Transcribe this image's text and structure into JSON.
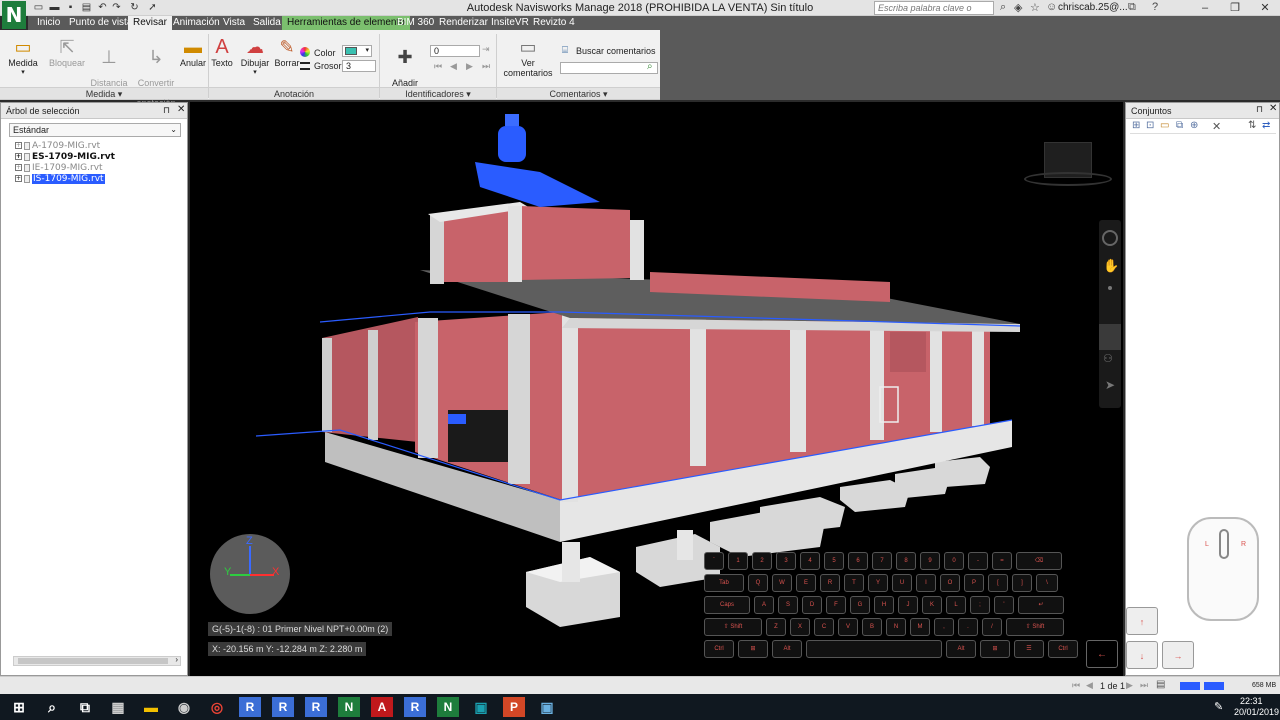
{
  "title_bar": {
    "app_letter": "N",
    "window_title": "Autodesk Navisworks Manage 2018 (PROHIBIDA LA VENTA)   Sin título",
    "search_placeholder": "Escriba palabra clave o frase",
    "user": "chriscab.25@...",
    "window_buttons": [
      "–",
      "❐",
      "✕"
    ]
  },
  "menu": {
    "tabs": [
      "Inicio",
      "Punto de vista",
      "Revisar",
      "Animación",
      "Vista",
      "Salida",
      "Herramientas de elemento",
      "BIM 360",
      "Renderizar",
      "InsiteVR",
      "Revizto 4"
    ],
    "active": "Revisar",
    "highlighted": "Herramientas de elemento"
  },
  "ribbon": {
    "medida": {
      "measure": "Medida",
      "lock": "Bloquear",
      "distance": "Distancia\nmás corta",
      "convert": "Convertir\nen anotación",
      "clear": "Anular",
      "group_label": "Medida"
    },
    "anotacion": {
      "text": "Texto",
      "draw": "Dibujar",
      "erase": "Borrar",
      "color_label": "Color",
      "thickness_label": "Grosor:",
      "thickness_value": "3",
      "group_label": "Anotación"
    },
    "identificadores": {
      "add": "Añadir\nidentificador",
      "id_value": "0",
      "group_label": "Identificadores"
    },
    "comentarios": {
      "view": "Ver comentarios",
      "search": "Buscar comentarios",
      "group_label": "Comentarios"
    }
  },
  "selection_tree": {
    "title": "Árbol de selección",
    "dropdown": "Estándar",
    "items": [
      {
        "label": "A-1709-MIG.rvt",
        "state": "dim"
      },
      {
        "label": "ES-1709-MIG.rvt",
        "state": "bold"
      },
      {
        "label": "IE-1709-MIG.rvt",
        "state": "dim"
      },
      {
        "label": "IS-1709-MIG.rvt",
        "state": "selected"
      }
    ]
  },
  "sets_panel": {
    "title": "Conjuntos"
  },
  "viewport": {
    "grid_location": "G(-5)-1(-8) : 01 Primer Nivel NPT+0.00m (2)",
    "coordinates": "X: -20.156 m  Y: -12.284 m  Z: 2.280 m",
    "axis_labels": {
      "z": "Z",
      "y": "Y",
      "x": "X"
    }
  },
  "keyboard": {
    "rows": [
      [
        "`",
        "1",
        "2",
        "3",
        "4",
        "5",
        "6",
        "7",
        "8",
        "9",
        "0",
        "-",
        "=",
        "⌫"
      ],
      [
        "Tab",
        "Q",
        "W",
        "E",
        "R",
        "T",
        "Y",
        "U",
        "I",
        "O",
        "P",
        "[",
        "]",
        "\\"
      ],
      [
        "Caps",
        "A",
        "S",
        "D",
        "F",
        "G",
        "H",
        "J",
        "K",
        "L",
        ";",
        "'",
        "↵"
      ],
      [
        "⇧ Shift",
        "Z",
        "X",
        "C",
        "V",
        "B",
        "N",
        "M",
        ",",
        ".",
        "/",
        "⇧ Shift"
      ],
      [
        "Ctrl",
        "⊞",
        "Alt",
        "",
        "Alt",
        "⊞",
        "☰",
        "Ctrl"
      ]
    ],
    "arrow_keys": {
      "up": "↑",
      "down": "↓",
      "right": "→",
      "left": "←"
    },
    "mouse_labels": {
      "left": "L",
      "right": "R"
    }
  },
  "status_bar": {
    "page": "1 de 1",
    "memory": "658 MB"
  },
  "taskbar": {
    "time": "22:31",
    "date": "20/01/2019",
    "apps": [
      "windows-icon",
      "search-icon",
      "task-view-icon",
      "calculator-icon",
      "file-explorer-icon",
      "app-icon",
      "chrome-icon",
      "revit-icon",
      "revit-icon",
      "revit-icon",
      "navisworks-icon",
      "autocad-icon",
      "revit-icon",
      "navisworks-icon",
      "screen-app-icon",
      "powerpoint-icon",
      "notepad-icon"
    ],
    "app_letters": [
      "",
      "",
      "",
      "",
      "",
      "",
      "",
      "R",
      "R",
      "R",
      "N",
      "A",
      "R",
      "N",
      "",
      "P",
      ""
    ]
  },
  "colors": {
    "accent": "#1e7d3c",
    "wall": "#c8636a",
    "concrete": "#e6e6e6",
    "roof": "#5e5e5e",
    "selection": "#2a5cff"
  }
}
